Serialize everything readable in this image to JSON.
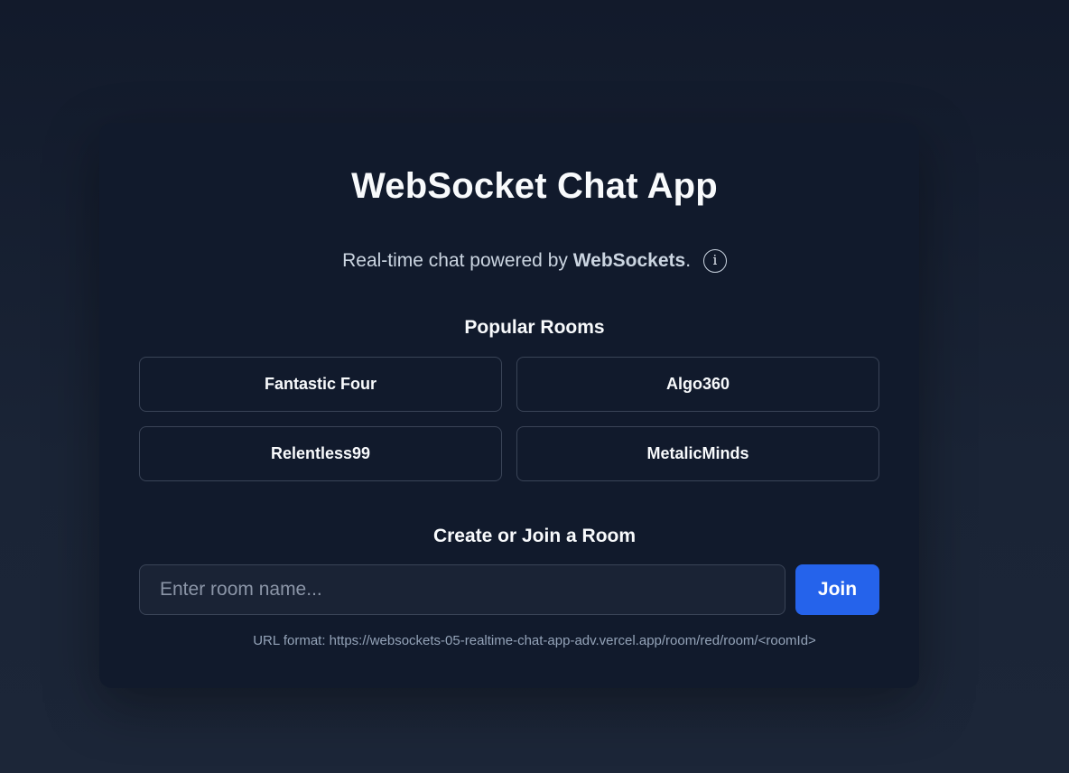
{
  "app": {
    "title": "WebSocket Chat App",
    "subtitle_prefix": "Real-time chat powered by ",
    "subtitle_bold": "WebSockets",
    "subtitle_suffix": ".",
    "info_icon_glyph": "i"
  },
  "popular_rooms": {
    "heading": "Popular Rooms",
    "rooms": [
      {
        "label": "Fantastic Four"
      },
      {
        "label": "Algo360"
      },
      {
        "label": "Relentless99"
      },
      {
        "label": "MetalicMinds"
      }
    ]
  },
  "join": {
    "heading": "Create or Join a Room",
    "input_value": "",
    "input_placeholder": "Enter room name...",
    "button_label": "Join",
    "url_hint": "URL format: https://websockets-05-realtime-chat-app-adv.vercel.app/room/red/room/<roomId>"
  },
  "colors": {
    "accent": "#2563eb",
    "card_bg": "#111a2c",
    "border": "#3a4457"
  }
}
